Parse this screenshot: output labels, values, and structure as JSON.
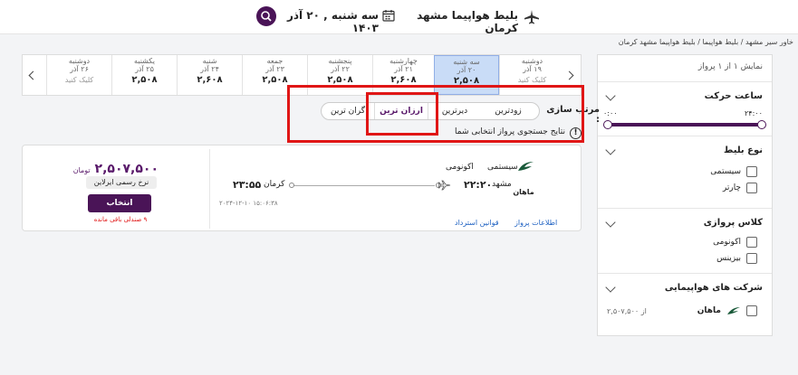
{
  "header": {
    "route_title": "بلیط هواپیما مشهد کرمان",
    "date_text": "سه شنبه , ۲۰ آذر ۱۴۰۳"
  },
  "breadcrumb": "خاور سیر مشهد / بلیط هواپیما / بلیط هواپیما مشهد کرمان",
  "sidebar": {
    "results_count": "نمایش ۱ از ۱ پرواز",
    "time_filter": {
      "title": "ساعت حرکت",
      "min": "۰:۰۰",
      "max": "۲۴:۰۰"
    },
    "ticket_type": {
      "title": "نوع بلیط",
      "options": [
        "سیستمی",
        "چارتر"
      ]
    },
    "flight_class": {
      "title": "کلاس پروازی",
      "options": [
        "اکونومی",
        "بیزینس"
      ]
    },
    "airlines": {
      "title": "شرکت های هواپیمایی",
      "items": [
        {
          "name": "ماهان",
          "price": "از ۲,۵۰۷,۵۰۰"
        }
      ]
    }
  },
  "date_strip": {
    "days": [
      {
        "day": "دوشنبه",
        "date": "۱۹ آذر",
        "price": "",
        "cta": "کلیک کنید"
      },
      {
        "day": "سه شنبه",
        "date": "۲۰ آذر",
        "price": "۲,۵۰۸",
        "cta": ""
      },
      {
        "day": "چهارشنبه",
        "date": "۲۱ آذر",
        "price": "۲,۶۰۸",
        "cta": ""
      },
      {
        "day": "پنجشنبه",
        "date": "۲۲ آذر",
        "price": "۲,۵۰۸",
        "cta": ""
      },
      {
        "day": "جمعه",
        "date": "۲۳ آذر",
        "price": "۲,۵۰۸",
        "cta": ""
      },
      {
        "day": "شنبه",
        "date": "۲۴ آذر",
        "price": "۲,۶۰۸",
        "cta": ""
      },
      {
        "day": "یکشنبه",
        "date": "۲۵ آذر",
        "price": "۲,۵۰۸",
        "cta": ""
      },
      {
        "day": "دوشنبه",
        "date": "۲۶ آذر",
        "price": "",
        "cta": "کلیک کنید"
      }
    ]
  },
  "sort": {
    "label": "مرتب سازی :",
    "options": [
      "زودترین",
      "دیرترین",
      "ارزان ترین",
      "گران ترین"
    ]
  },
  "info_text": "نتایج جستجوی پرواز انتخابی شما",
  "flight": {
    "airline": "ماهان",
    "ticket_type": "سیستمی",
    "cabin": "اکونومی",
    "origin": "مشهد",
    "dep_time": "۲۲:۲۰",
    "destination": "کرمان",
    "arr_time": "۲۳:۵۵",
    "datetime": "۲۰۲۴-۱۲-۱۰ ۱۵:۰۶:۳۸",
    "price": "۲,۵۰۷,۵۰۰",
    "currency": "تومان",
    "fare_badge": "نرخ رسمی ایرلاین",
    "select_label": "انتخاب",
    "seats_left": "۹ صندلی باقی مانده",
    "link_info": "اطلاعات پرواز",
    "link_refund": "قوانین استرداد"
  },
  "colors": {
    "brand": "#4a1457",
    "accent": "#5a1a6b",
    "highlight": "#e01616",
    "selected_date": "#c9dcf7"
  }
}
